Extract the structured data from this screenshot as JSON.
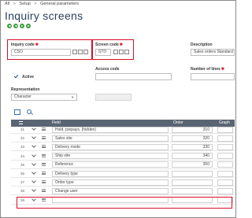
{
  "breadcrumb": {
    "all": "All",
    "setup": "Setup",
    "general_parameters": "General parameters",
    "separator": ">"
  },
  "page_title": "Inquiry screens",
  "form": {
    "inquiry_code": {
      "label": "Inquiry code",
      "value": "CSO"
    },
    "screen_code": {
      "label": "Screen code",
      "value": "STD"
    },
    "description": {
      "label": "Description",
      "value": "Sales orders Standard"
    },
    "active": {
      "label": "Active",
      "checked": true
    },
    "access_code": {
      "label": "Access code",
      "value": ""
    },
    "number_of_lines": {
      "label": "Number of lines",
      "value": ""
    },
    "representation": {
      "label": "Representation",
      "value": "Character"
    },
    "required_marker": "✱"
  },
  "table": {
    "headers": {
      "field": "Field",
      "order": "Order",
      "graph": "Graph"
    },
    "rows": [
      {
        "num": "31",
        "field": "Hold, prepays, (hidden)",
        "order": "310"
      },
      {
        "num": "32",
        "field": "Sales site",
        "order": "320"
      },
      {
        "num": "33",
        "field": "Delivery mode",
        "order": "330"
      },
      {
        "num": "34",
        "field": "Ship site",
        "order": "340"
      },
      {
        "num": "35",
        "field": "Reference",
        "order": "350"
      },
      {
        "num": "36",
        "field": "Delivery type",
        "order": ""
      },
      {
        "num": "37",
        "field": "Order type",
        "order": ""
      },
      {
        "num": "38",
        "field": "Change user",
        "order": ""
      },
      {
        "num": "39",
        "field": "",
        "order": ""
      }
    ]
  },
  "colors": {
    "highlight": "#d6102a",
    "header_bg": "#5a6573",
    "title": "#2a3f5a",
    "nav_button": "#3f9b3f",
    "required": "#d21e2b"
  }
}
